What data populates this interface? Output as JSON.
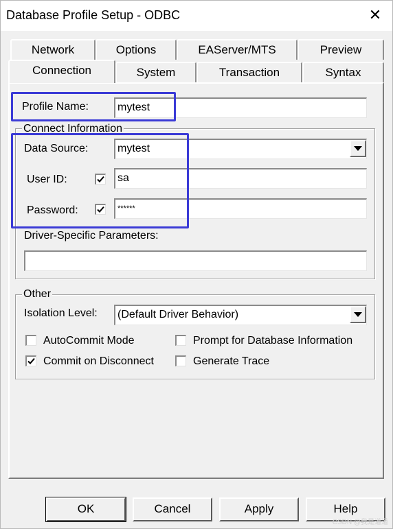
{
  "window": {
    "title": "Database Profile Setup - ODBC",
    "close_glyph": "✕"
  },
  "tabs": {
    "row_back": [
      {
        "label": "Network"
      },
      {
        "label": "Options"
      },
      {
        "label": "EAServer/MTS"
      },
      {
        "label": "Preview"
      }
    ],
    "row_front": [
      {
        "label": "Connection",
        "active": true
      },
      {
        "label": "System"
      },
      {
        "label": "Transaction"
      },
      {
        "label": "Syntax"
      }
    ]
  },
  "connection": {
    "profile_name_label": "Profile Name:",
    "profile_name_value": "mytest",
    "connect_group_label": "Connect Information",
    "data_source_label": "Data Source:",
    "data_source_value": "mytest",
    "user_id_label": "User ID:",
    "user_id_checked": true,
    "user_id_value": "sa",
    "password_label": "Password:",
    "password_checked": true,
    "password_value": "******",
    "driver_params_label": "Driver-Specific Parameters:",
    "driver_params_value": ""
  },
  "other": {
    "group_label": "Other",
    "isolation_label": "Isolation Level:",
    "isolation_value": "(Default Driver Behavior)",
    "autocommit_label": "AutoCommit Mode",
    "autocommit_checked": false,
    "commit_disconnect_label": "Commit on Disconnect",
    "commit_disconnect_checked": true,
    "prompt_label": "Prompt for Database Information",
    "prompt_checked": false,
    "trace_label": "Generate Trace",
    "trace_checked": false
  },
  "buttons": {
    "ok": "OK",
    "cancel": "Cancel",
    "apply": "Apply",
    "help": "Help"
  },
  "watermark": "CSDN @我是道道",
  "colors": {
    "highlight": "#3a3ad6",
    "face": "#f0f0f0"
  }
}
